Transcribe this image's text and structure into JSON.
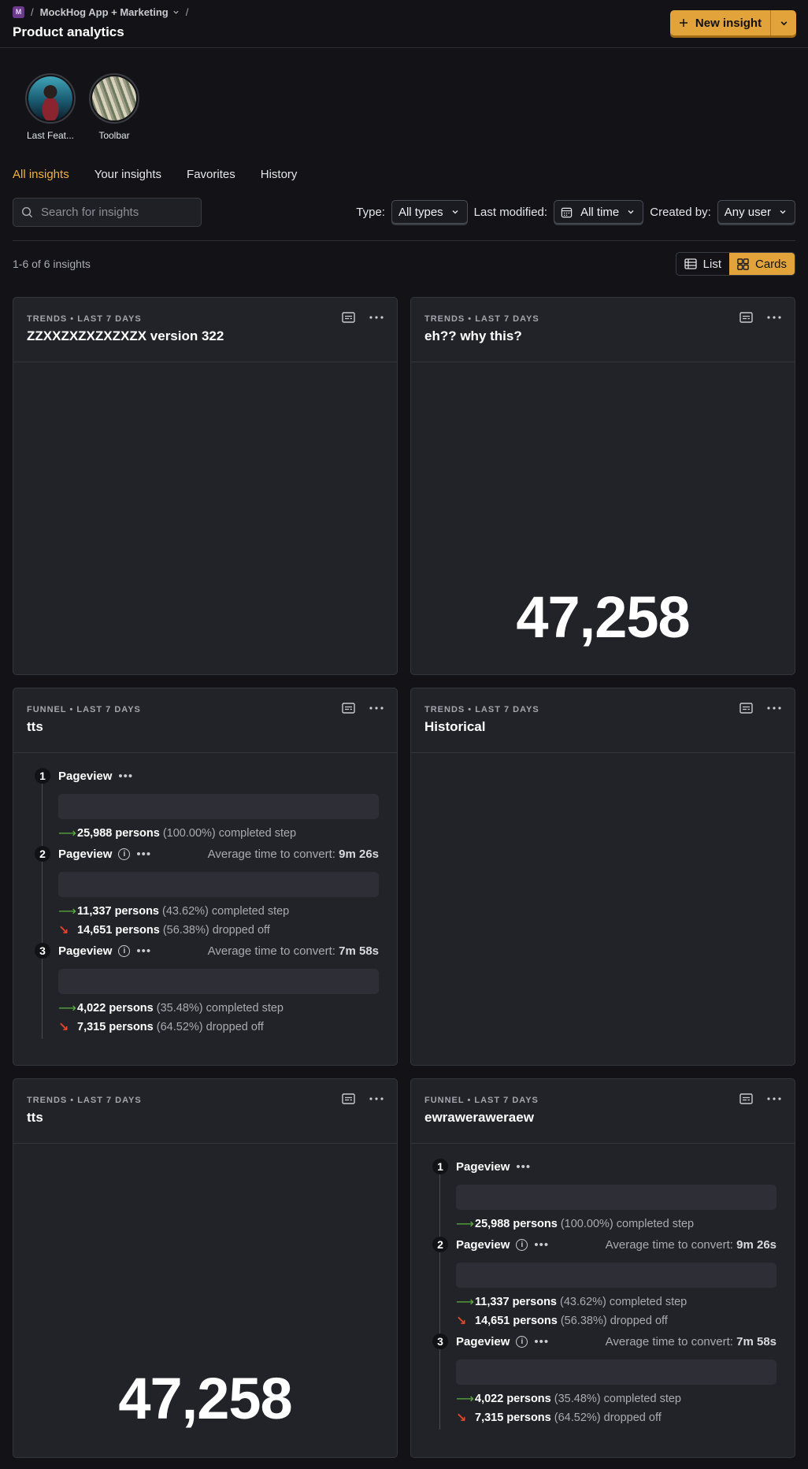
{
  "header": {
    "project_badge": "M",
    "project_name": "MockHog App + Marketing",
    "title": "Product analytics",
    "new_insight_label": "New insight"
  },
  "shortcuts": [
    {
      "label": "Last Feat..."
    },
    {
      "label": "Toolbar"
    }
  ],
  "tabs": [
    "All insights",
    "Your insights",
    "Favorites",
    "History"
  ],
  "filters": {
    "search_placeholder": "Search for insights",
    "type_label": "Type:",
    "type_value": "All types",
    "modified_label": "Last modified:",
    "modified_value": "All time",
    "created_label": "Created by:",
    "created_value": "Any user"
  },
  "results": {
    "count": "1-6 of 6 insights",
    "view_list": "List",
    "view_cards": "Cards"
  },
  "cards": [
    {
      "meta": "TRENDS • LAST 7 DAYS",
      "title": "ZZXXZXZXZXZXZX version 322",
      "number": ""
    },
    {
      "meta": "TRENDS • LAST 7 DAYS",
      "title": "eh?? why this?",
      "number": "47,258"
    },
    {
      "meta": "FUNNEL • LAST 7 DAYS",
      "title": "tts"
    },
    {
      "meta": "TRENDS • LAST 7 DAYS",
      "title": "Historical"
    },
    {
      "meta": "TRENDS • LAST 7 DAYS",
      "title": "tts",
      "number": "47,258"
    },
    {
      "meta": "FUNNEL • LAST 7 DAYS",
      "title": "ewraweraweraew"
    }
  ],
  "funnel": {
    "steps": [
      {
        "num": "1",
        "name": "Pageview",
        "avg_label": "",
        "avg_value": "",
        "completed_persons": "25,988 persons",
        "completed_pct": "(100.00%)",
        "completed_text": "completed step",
        "dropped_persons": "",
        "dropped_pct": "",
        "dropped_text": ""
      },
      {
        "num": "2",
        "name": "Pageview",
        "avg_label": "Average time to convert:",
        "avg_value": "9m 26s",
        "completed_persons": "11,337 persons",
        "completed_pct": "(43.62%)",
        "completed_text": "completed step",
        "dropped_persons": "14,651 persons",
        "dropped_pct": "(56.38%)",
        "dropped_text": "dropped off"
      },
      {
        "num": "3",
        "name": "Pageview",
        "avg_label": "Average time to convert:",
        "avg_value": "7m 58s",
        "completed_persons": "4,022 persons",
        "completed_pct": "(35.48%)",
        "completed_text": "completed step",
        "dropped_persons": "7,315 persons",
        "dropped_pct": "(64.52%)",
        "dropped_text": "dropped off"
      }
    ]
  },
  "icons": {
    "plus": "plus-icon",
    "chevron": "chevron-down-icon",
    "search": "search-icon",
    "calendar": "calendar-icon",
    "list": "list-icon",
    "cards": "cards-icon",
    "description": "description-icon",
    "more": "more-icon",
    "info": "info-icon",
    "arrow_right": "arrow-right-icon",
    "arrow_down_right": "arrow-down-right-icon"
  },
  "colors": {
    "accent": "#e3a33b",
    "active_tab": "#f3b13d",
    "completed": "#57b03b",
    "dropped": "#e0452c",
    "background": "#131317",
    "card": "#222328"
  }
}
